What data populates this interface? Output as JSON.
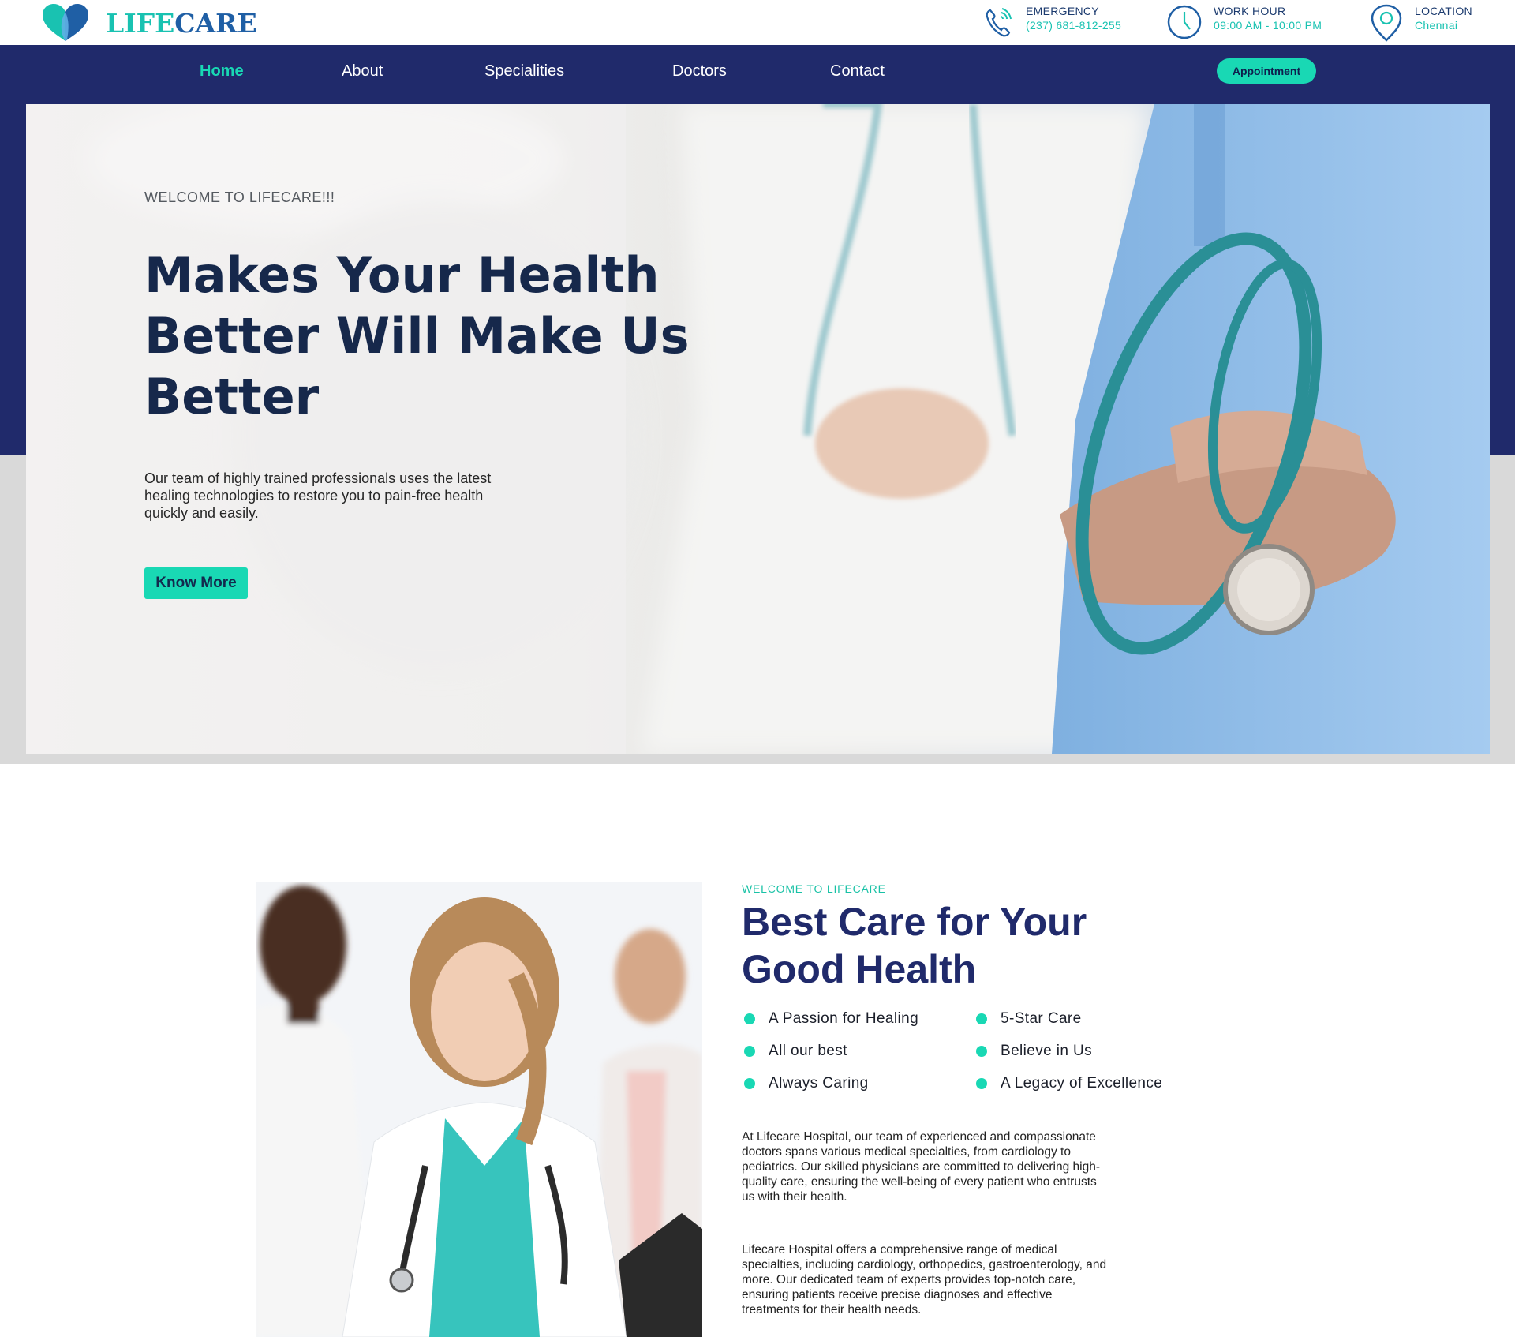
{
  "brand": {
    "part1": "LIFE",
    "part2": "CARE",
    "color_teal": "#19c2b1",
    "color_blue": "#1f5fa5"
  },
  "header": {
    "emergency": {
      "label": "EMERGENCY",
      "value": "(237) 681-812-255",
      "icon": "phone-icon"
    },
    "work_hour": {
      "label": "WORK HOUR",
      "value": "09:00 AM - 10:00 PM",
      "icon": "clock-icon"
    },
    "location": {
      "label": "LOCATION",
      "value": "Chennai",
      "icon": "map-pin-icon"
    }
  },
  "nav": {
    "items": [
      {
        "label": "Home",
        "active": true
      },
      {
        "label": "About"
      },
      {
        "label": "Specialities"
      },
      {
        "label": "Doctors"
      },
      {
        "label": "Contact"
      }
    ],
    "cta": "Appointment",
    "bg_color": "#202a6b",
    "accent": "#19d8b4"
  },
  "hero": {
    "welcome": "WELCOME TO LIFECARE!!!",
    "title": "Makes Your Health Better Will Make Us Better",
    "description": "Our team of highly trained professionals uses the latest healing technologies to restore you to pain-free health quickly and easily.",
    "button": "Know More"
  },
  "about": {
    "kicker": "WELCOME TO LIFECARE",
    "title": "Best Care for Your Good Health",
    "features": [
      "A Passion for Healing",
      "5-Star Care",
      "All our best",
      "Believe in Us",
      "Always Caring",
      "A Legacy of Excellence"
    ],
    "paragraph1": "At Lifecare Hospital, our team of experienced and compassionate doctors spans various medical specialties, from cardiology to pediatrics. Our skilled physicians are committed to delivering high-quality care, ensuring the well-being of every patient who entrusts us with their health.",
    "paragraph2": "Lifecare Hospital offers a comprehensive range of medical specialties, including cardiology, orthopedics, gastroenterology, and more. Our dedicated team of experts provides top-notch care, ensuring patients receive precise diagnoses and effective treatments for their health needs."
  }
}
